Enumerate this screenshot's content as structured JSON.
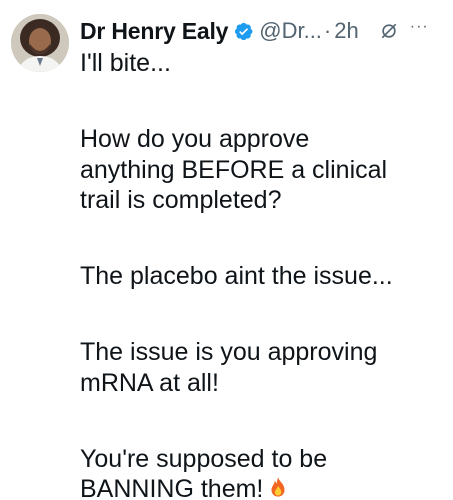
{
  "author": {
    "display_name": "Dr Henry Ealy",
    "handle": "@Dr...",
    "separator": "·",
    "time": "2h",
    "verified_color": "#1d9bf0"
  },
  "icons": {
    "verified": "verified-badge-icon",
    "grok": "grok-icon",
    "more": "more-options-icon",
    "emoji": "fire-emoji"
  },
  "more_label": "···",
  "tweet": {
    "paragraphs": [
      [
        "I'll bite..."
      ],
      [
        "How do you approve",
        "anything BEFORE a clinical",
        "trail is completed?"
      ],
      [
        "The placebo aint the issue..."
      ],
      [
        "The issue is you approving",
        "mRNA at all!"
      ],
      [
        "You're supposed to be",
        "BANNING them!"
      ]
    ]
  }
}
